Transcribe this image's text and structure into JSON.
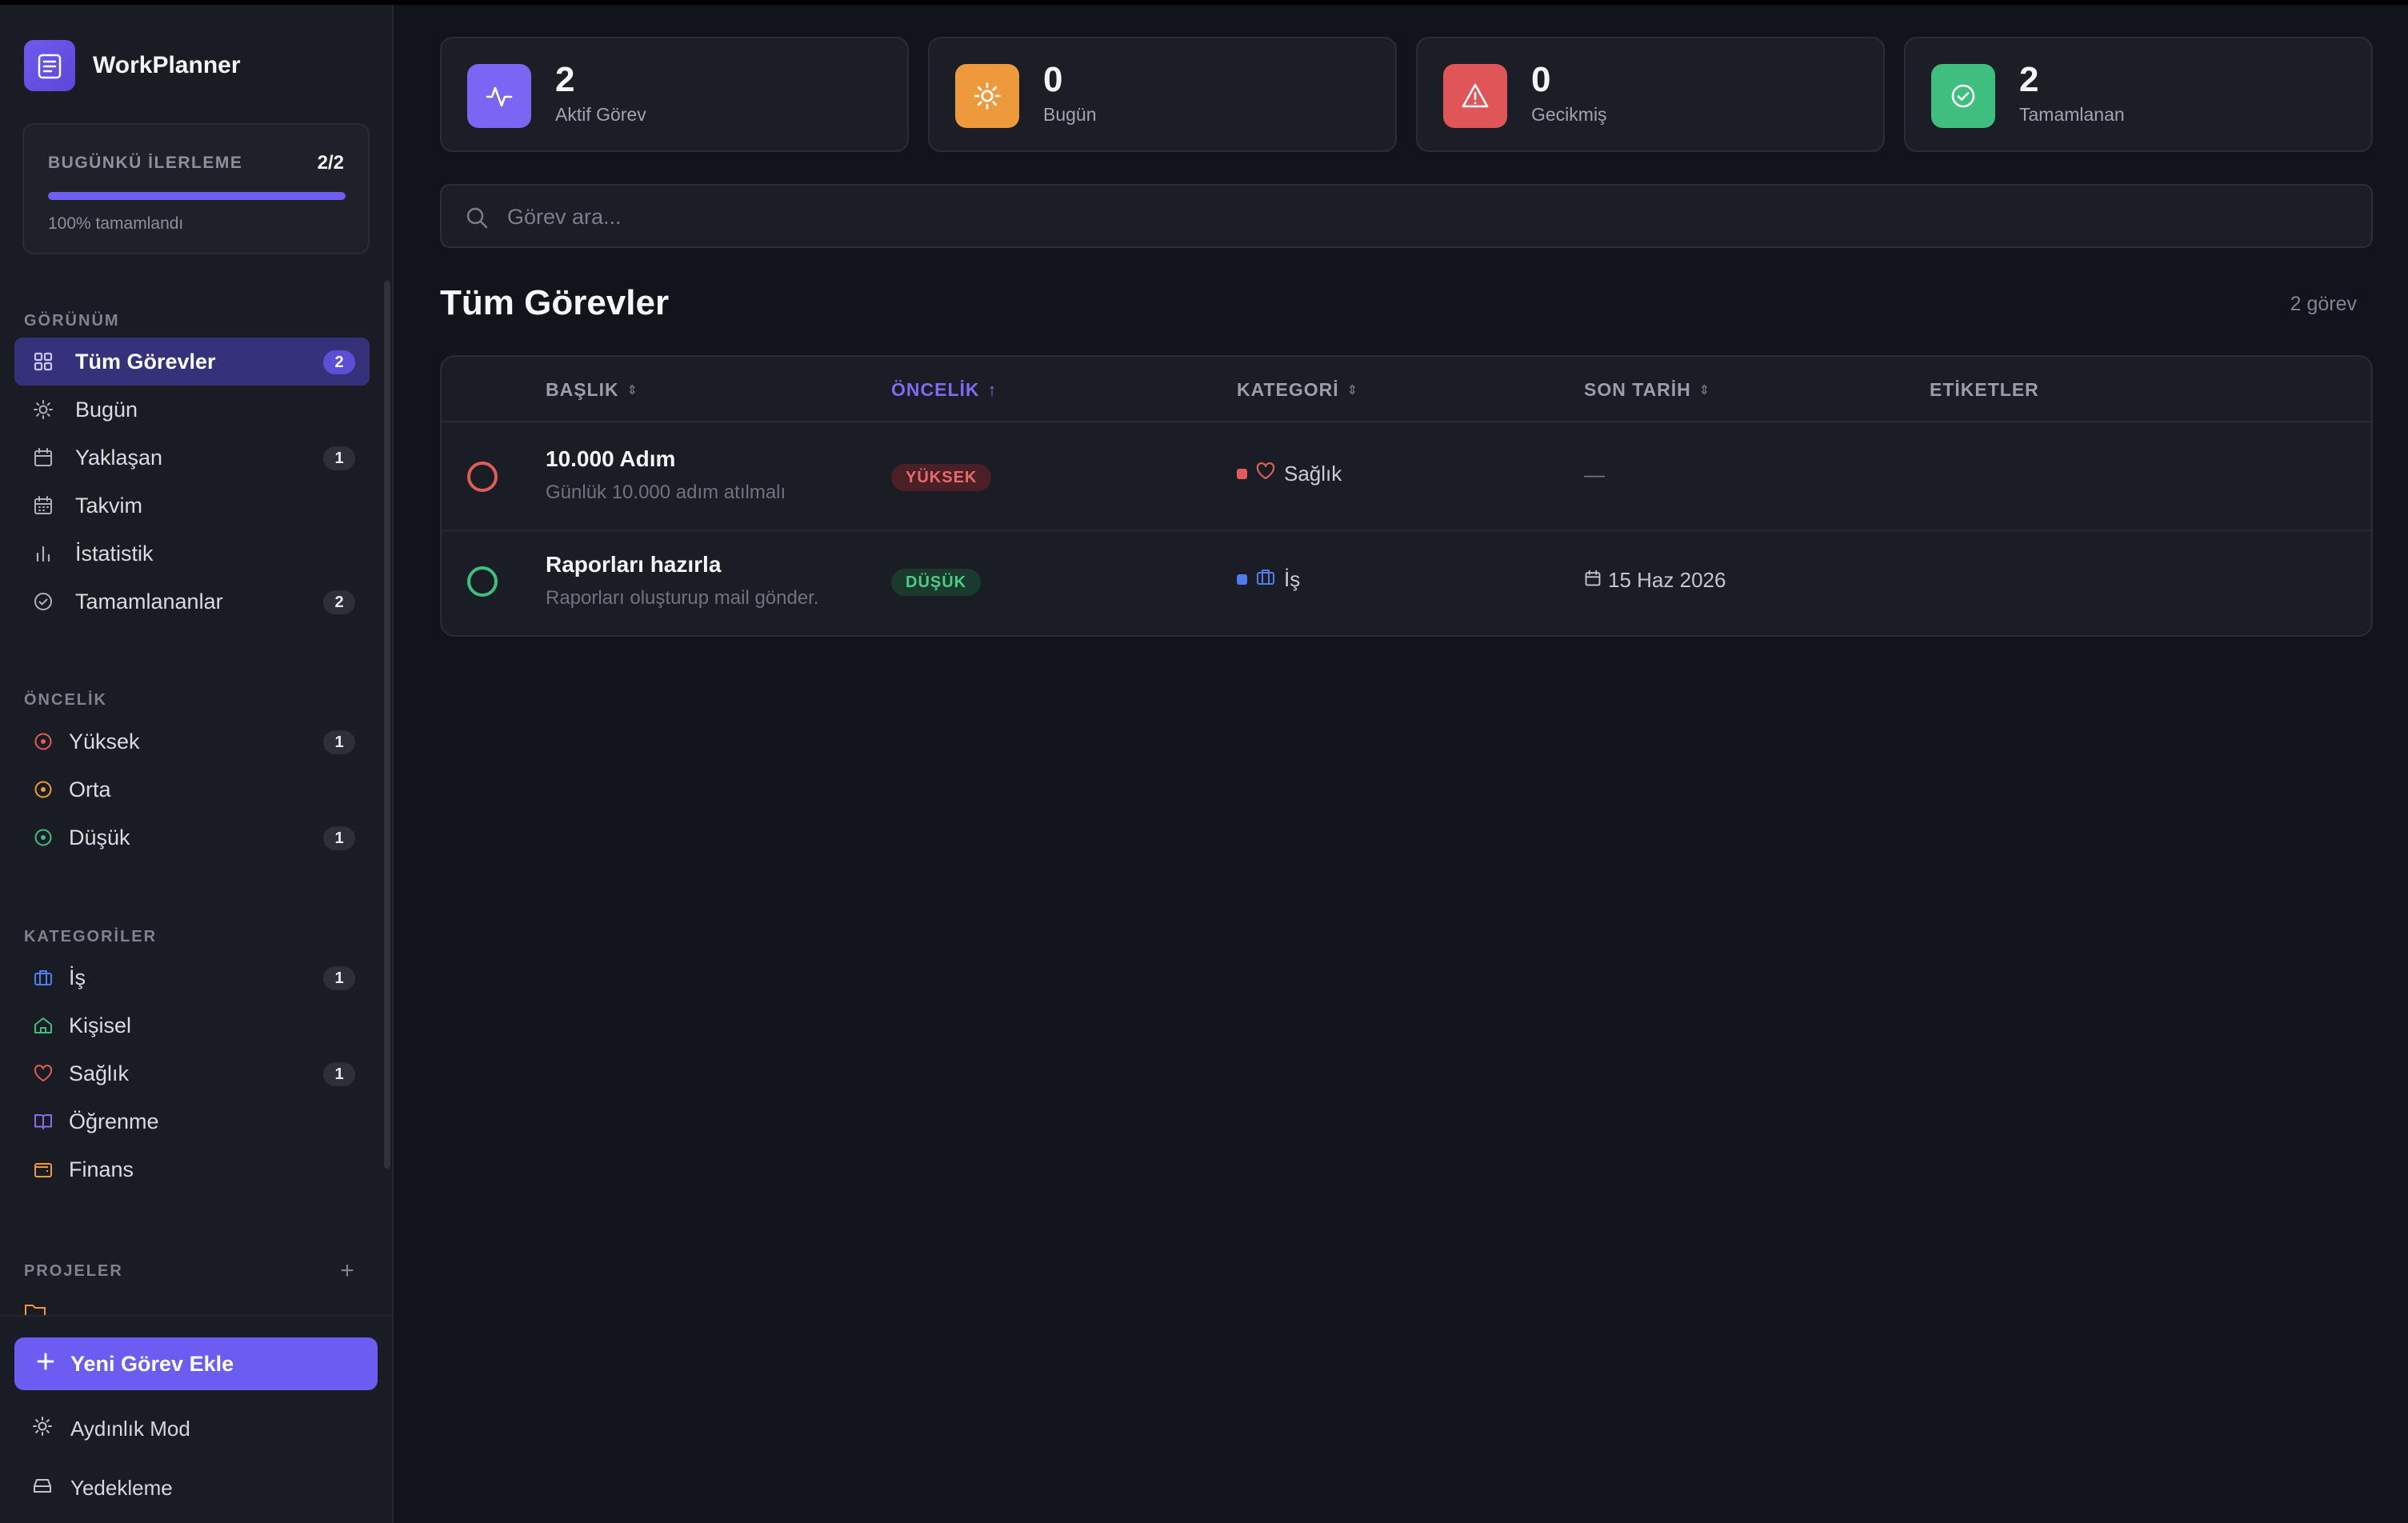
{
  "app": {
    "name": "WorkPlanner"
  },
  "progress": {
    "title": "BUGÜNKÜ İLERLEME",
    "count": "2/2",
    "percent": 100,
    "subtitle": "100% tamamlandı"
  },
  "sections": {
    "view": "GÖRÜNÜM",
    "priority": "ÖNCELİK",
    "categories": "KATEGORİLER",
    "projects": "PROJELER"
  },
  "nav_view": [
    {
      "label": "Tüm Görevler",
      "badge": "2",
      "icon": "grid-icon",
      "active": true
    },
    {
      "label": "Bugün",
      "badge": "",
      "icon": "sun-icon"
    },
    {
      "label": "Yaklaşan",
      "badge": "1",
      "icon": "calendar-icon"
    },
    {
      "label": "Takvim",
      "badge": "",
      "icon": "calendar-grid-icon"
    },
    {
      "label": "İstatistik",
      "badge": "",
      "icon": "bar-chart-icon"
    },
    {
      "label": "Tamamlananlar",
      "badge": "2",
      "icon": "check-circle-icon"
    }
  ],
  "nav_priority": [
    {
      "label": "Yüksek",
      "badge": "1",
      "color": "#e05b5b"
    },
    {
      "label": "Orta",
      "badge": "",
      "color": "#ee9a3c"
    },
    {
      "label": "Düşük",
      "badge": "1",
      "color": "#3fbf7f"
    }
  ],
  "nav_categories": [
    {
      "label": "İş",
      "badge": "1",
      "icon": "briefcase-icon",
      "color": "#4f7df0"
    },
    {
      "label": "Kişisel",
      "badge": "",
      "icon": "home-icon",
      "color": "#3fbf7f"
    },
    {
      "label": "Sağlık",
      "badge": "1",
      "icon": "heart-icon",
      "color": "#e05b5b"
    },
    {
      "label": "Öğrenme",
      "badge": "",
      "icon": "book-icon",
      "color": "#8b6cf0"
    },
    {
      "label": "Finans",
      "badge": "",
      "icon": "wallet-icon",
      "color": "#ee9a3c"
    }
  ],
  "footer": {
    "add_task": "Yeni Görev Ekle",
    "light_mode": "Aydınlık Mod",
    "backup": "Yedekleme"
  },
  "stats": [
    {
      "value": "2",
      "label": "Aktif Görev",
      "icon": "activity-icon",
      "color": "#7a66f2"
    },
    {
      "value": "0",
      "label": "Bugün",
      "icon": "sun-icon",
      "color": "#ee9a3c"
    },
    {
      "value": "0",
      "label": "Gecikmiş",
      "icon": "warning-icon",
      "color": "#e05555"
    },
    {
      "value": "2",
      "label": "Tamamlanan",
      "icon": "check-circle-icon",
      "color": "#3fbf7f"
    }
  ],
  "search": {
    "placeholder": "Görev ara..."
  },
  "main": {
    "title": "Tüm Görevler",
    "count": "2 görev"
  },
  "table": {
    "columns": [
      "BAŞLIK",
      "ÖNCELİK",
      "KATEGORİ",
      "SON TARİH",
      "ETİKETLER"
    ],
    "sorted_column": "ÖNCELİK",
    "rows": [
      {
        "title": "10.000 Adım",
        "description": "Günlük 10.000 adım atılmalı",
        "priority": "YÜKSEK",
        "priority_color": "#e05b5b",
        "priority_bg": "#4a2026",
        "category": "Sağlık",
        "category_icon": "heart-icon",
        "category_color": "#e05b5b",
        "due": "—",
        "check_color": "#e05b5b"
      },
      {
        "title": "Raporları hazırla",
        "description": "Raporları oluşturup mail gönder.",
        "priority": "DÜŞÜK",
        "priority_color": "#3fbf7f",
        "priority_bg": "#193a2d",
        "category": "İş",
        "category_icon": "briefcase-icon",
        "category_color": "#4f7df0",
        "due": "15 Haz 2026",
        "check_color": "#3fbf7f"
      }
    ]
  }
}
